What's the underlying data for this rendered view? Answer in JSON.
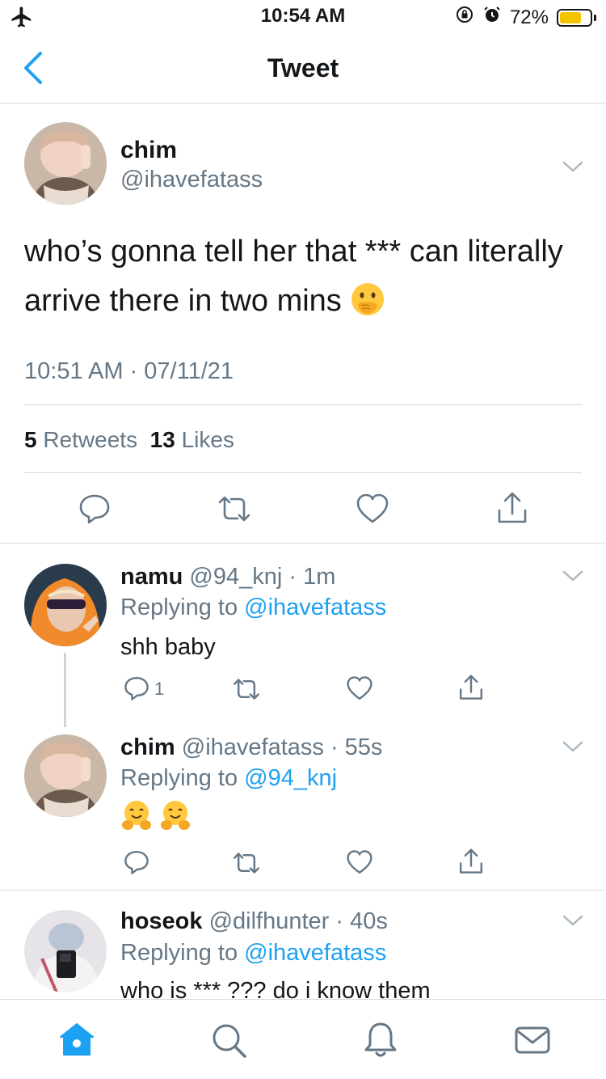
{
  "status_bar": {
    "time": "10:54 AM",
    "battery_percent": "72%",
    "battery_level": 0.72
  },
  "header": {
    "title": "Tweet"
  },
  "main_tweet": {
    "name": "chim",
    "handle": "@ihavefatass",
    "text": "who’s gonna tell her that *** can literally arrive there in two mins",
    "emoji": "face-with-hand-over-mouth",
    "timestamp": "10:51 AM · 07/11/21",
    "retweets_count": "5",
    "retweets_label": "Retweets",
    "likes_count": "13",
    "likes_label": "Likes"
  },
  "replies": [
    {
      "name": "namu",
      "handle": "@94_knj",
      "time": "1m",
      "replying_prefix": "Replying to",
      "replying_to": "@ihavefatass",
      "text": "shh baby",
      "reply_count": "1"
    },
    {
      "name": "chim",
      "handle": "@ihavefatass",
      "time": "55s",
      "replying_prefix": "Replying to",
      "replying_to": "@94_knj",
      "text": "",
      "emojis": [
        "hugging-face",
        "hugging-face"
      ]
    },
    {
      "name": "hoseok",
      "handle": "@dilfhunter",
      "time": "40s",
      "replying_prefix": "Replying to",
      "replying_to": "@ihavefatass",
      "text": "who is *** ??? do i know them"
    }
  ],
  "tab_bar": {
    "items": [
      "home-icon",
      "search-icon",
      "notifications-icon",
      "messages-icon"
    ]
  },
  "colors": {
    "link": "#1da1f2",
    "secondary_text": "#657786",
    "divider": "#d6d9db",
    "primary_text": "#14171a"
  }
}
